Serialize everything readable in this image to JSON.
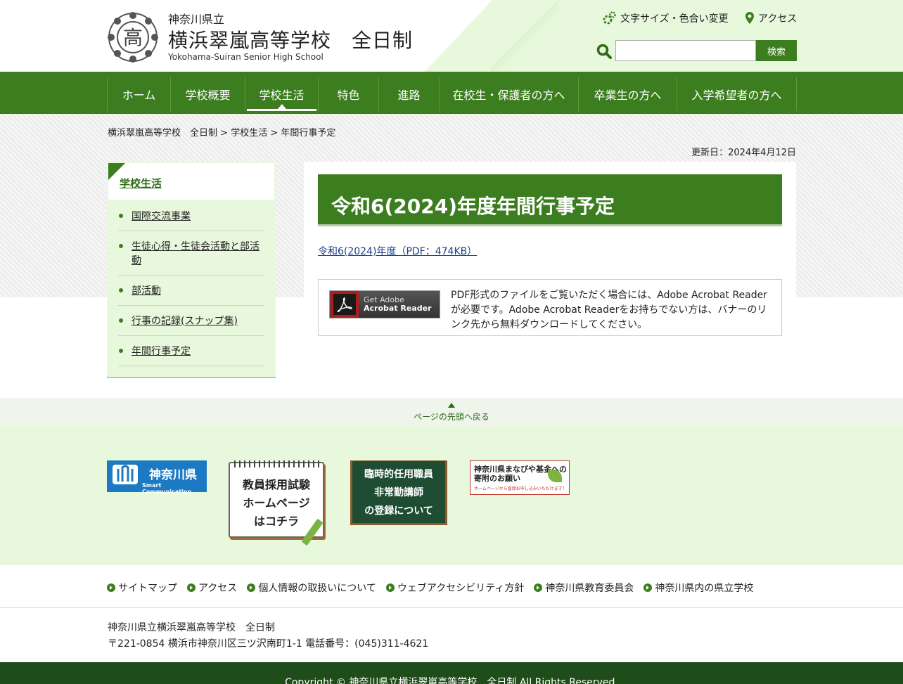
{
  "header": {
    "school_prefix": "神奈川県立",
    "school_name": "横浜翠嵐高等学校　全日制",
    "school_name_en": "Yokohama-Suiran Senior High School",
    "font_color_link": "文字サイズ・色合い変更",
    "access_link": "アクセス",
    "search_placeholder": "",
    "search_button": "検索",
    "logo_icon": "school-crest-icon"
  },
  "nav": {
    "items": [
      "ホーム",
      "学校概要",
      "学校生活",
      "特色",
      "進路",
      "在校生・保護者の方へ",
      "卒業生の方へ",
      "入学希望者の方へ"
    ],
    "active": "学校生活"
  },
  "breadcrumb": {
    "home": "横浜翠嵐高等学校　全日制",
    "sep1": " > ",
    "section": "学校生活",
    "sep2": " > ",
    "current": "年間行事予定"
  },
  "updated": "更新日：2024年4月12日",
  "sidebar": {
    "title": "学校生活",
    "items": [
      "国際交流事業",
      "生徒心得・生徒会活動と部活動",
      "部活動",
      "行事の記録(スナップ集)",
      "年間行事予定"
    ]
  },
  "main": {
    "title": "令和6(2024)年度年間行事予定",
    "pdf_link": "令和6(2024)年度（PDF：474KB）",
    "adobe_get": "Get Adobe",
    "adobe_product": "Acrobat Reader",
    "adobe_desc": "PDF形式のファイルをご覧いただく場合には、Adobe Acrobat Readerが必要です。Adobe Acrobat Readerをお持ちでない方は、バナーのリンク先から無料ダウンロードしてください。"
  },
  "pagetop": "ページの先頭へ戻る",
  "banners": {
    "kanagawa": "神奈川県",
    "kanagawa_sub": "Smart Communication",
    "teacher_exam": "教員採用試験\nホームページ\nはコチラ",
    "temp_staff": "臨時的任用職員\n非常勤講師\nの登録について",
    "fund": "神奈川県まなびや基金への\n寄附のお願い",
    "fund_sub": "ホームページから直接お申し込みいただけます！"
  },
  "footer": {
    "links": [
      "サイトマップ",
      "アクセス",
      "個人情報の取扱いについて",
      "ウェブアクセシビリティ方針",
      "神奈川県教育委員会",
      "神奈川県内の県立学校"
    ],
    "address_line1": "神奈川県立横浜翠嵐高等学校　全日制",
    "address_line2": "〒221-0854 横浜市神奈川区三ツ沢南町1-1 電話番号：(045)311-4621",
    "copyright": "Copyright © 神奈川県立横浜翠嵐高等学校　全日制 All Rights Reserved."
  },
  "colors": {
    "brand_green": "#3c7d1f",
    "light_green": "#e8f8dc",
    "footer_dark": "#1f4d1a",
    "link_blue": "#1a3f8a"
  }
}
